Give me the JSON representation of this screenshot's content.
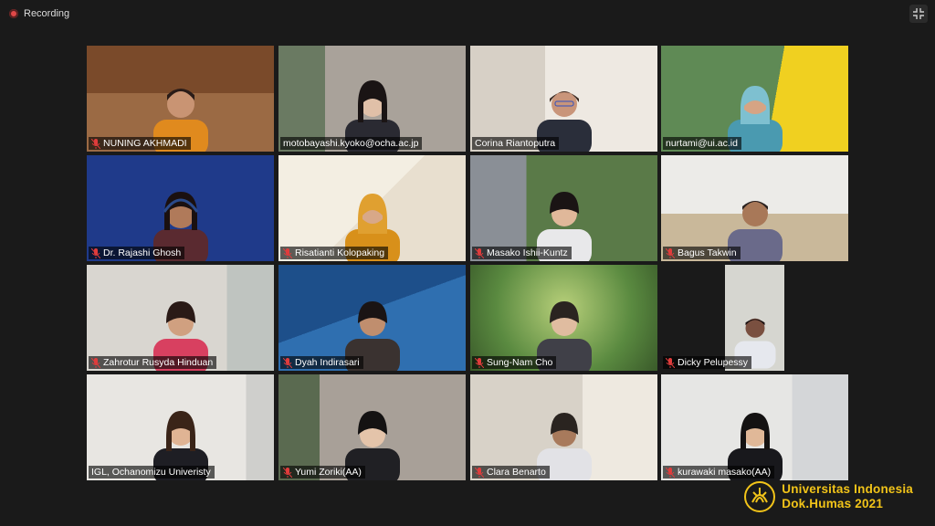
{
  "window": {
    "recording_label": "Recording"
  },
  "participants": [
    {
      "name": "NUNING AKHMADI",
      "muted": true
    },
    {
      "name": "motobayashi.kyoko@ocha.ac.jp",
      "muted": false
    },
    {
      "name": "Corina Riantoputra",
      "muted": false
    },
    {
      "name": "nurtami@ui.ac.id",
      "muted": false
    },
    {
      "name": "Dr. Rajashi Ghosh",
      "muted": true
    },
    {
      "name": "Risatianti Kolopaking",
      "muted": true
    },
    {
      "name": "Masako Ishii-Kuntz",
      "muted": true
    },
    {
      "name": "Bagus Takwin",
      "muted": true
    },
    {
      "name": "Zahrotur Rusyda Hinduan",
      "muted": true
    },
    {
      "name": "Dyah Indirasari",
      "muted": true
    },
    {
      "name": "Sung-Nam Cho",
      "muted": true
    },
    {
      "name": "Dicky Pelupessy",
      "muted": true
    },
    {
      "name": "IGL, Ochanomizu Univeristy",
      "muted": false,
      "active_speaker": true
    },
    {
      "name": "Yumi Zoriki(AA)",
      "muted": true
    },
    {
      "name": "Clara Benarto",
      "muted": true
    },
    {
      "name": "kurawaki masako(AA)",
      "muted": true
    }
  ],
  "watermark": {
    "line1": "Universitas Indonesia",
    "line2": "Dok.Humas 2021"
  },
  "colors": {
    "watermark": "#f2c419",
    "active_border": "#c9e07a",
    "recording_dot": "#e04848",
    "muted_mic": "#e03c3c"
  }
}
